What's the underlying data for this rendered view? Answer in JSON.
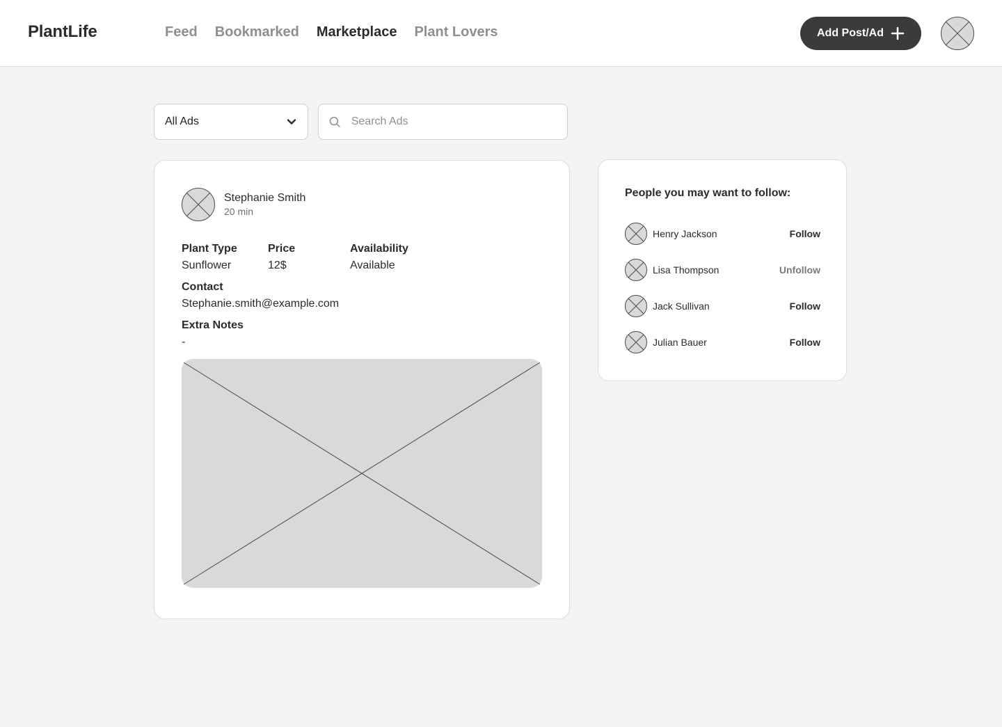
{
  "header": {
    "logo": "PlantLife",
    "nav": [
      {
        "label": "Feed",
        "active": false
      },
      {
        "label": "Bookmarked",
        "active": false
      },
      {
        "label": "Marketplace",
        "active": true
      },
      {
        "label": "Plant Lovers",
        "active": false
      }
    ],
    "add_button_label": "Add Post/Ad"
  },
  "filters": {
    "ads_filter_value": "All Ads",
    "search_placeholder": "Search Ads"
  },
  "post": {
    "author": "Stephanie Smith",
    "time": "20 min",
    "plant_type_label": "Plant Type",
    "plant_type_value": "Sunflower",
    "price_label": "Price",
    "price_value": "12$",
    "availability_label": "Availability",
    "availability_value": "Available",
    "contact_label": "Contact",
    "contact_value": "Stephanie.smith@example.com",
    "notes_label": "Extra Notes",
    "notes_value": "-"
  },
  "suggestions": {
    "title": "People you may want to follow:",
    "people": [
      {
        "name": "Henry Jackson",
        "action": "Follow"
      },
      {
        "name": "Lisa Thompson",
        "action": "Unfollow"
      },
      {
        "name": "Jack Sullivan",
        "action": "Follow"
      },
      {
        "name": "Julian Bauer",
        "action": "Follow"
      }
    ]
  },
  "colors": {
    "background": "#f4f4f4",
    "card": "#ffffff",
    "primary_button": "#3b3b3b",
    "placeholder_fill": "#d9d9d9",
    "muted_text": "#8f8f8f"
  },
  "icons": {
    "add": "plus-icon",
    "dropdown": "chevron-down-icon",
    "search": "search-icon",
    "avatar": "avatar-placeholder-icon",
    "image": "image-placeholder-icon"
  }
}
